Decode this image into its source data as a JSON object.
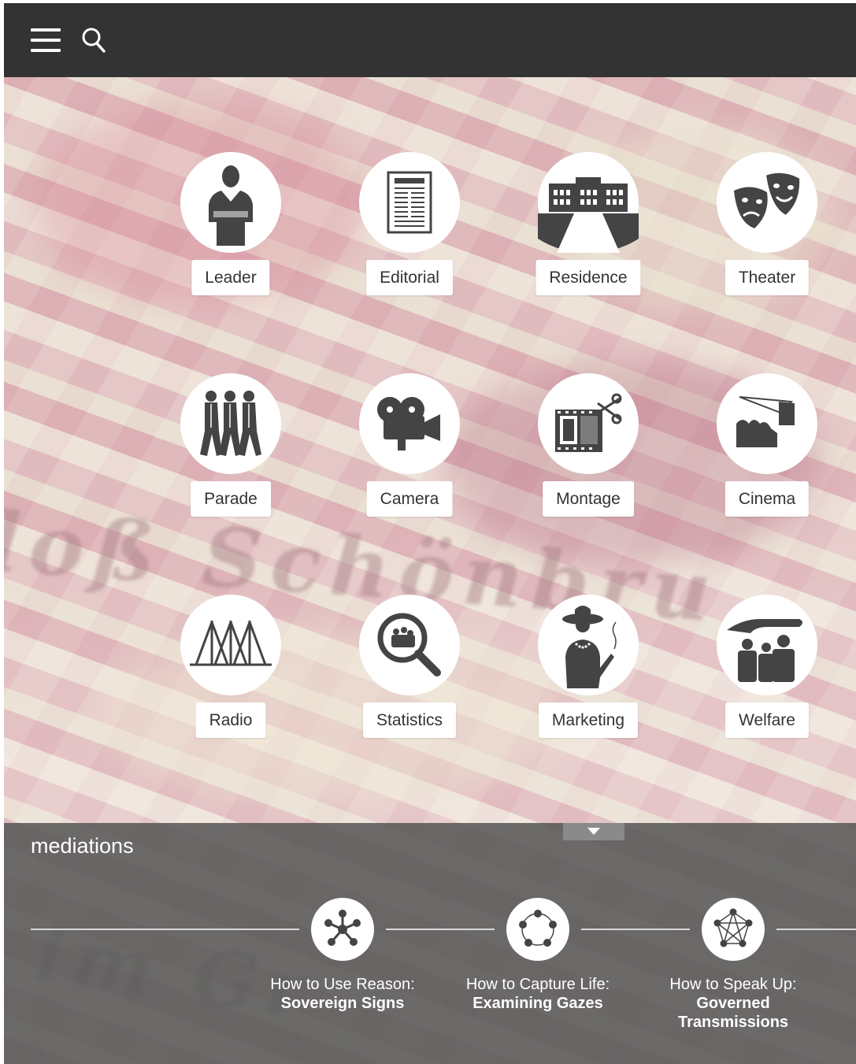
{
  "header": {
    "menu_icon": "hamburger-menu-icon",
    "search_icon": "search-icon",
    "bg_color": "#333333"
  },
  "grid": {
    "items": [
      {
        "label": "Leader",
        "icon": "leader-icon"
      },
      {
        "label": "Editorial",
        "icon": "newspaper-icon"
      },
      {
        "label": "Residence",
        "icon": "palace-icon"
      },
      {
        "label": "Theater",
        "icon": "theater-masks-icon"
      },
      {
        "label": "Parade",
        "icon": "marching-soldiers-icon"
      },
      {
        "label": "Camera",
        "icon": "film-camera-icon"
      },
      {
        "label": "Montage",
        "icon": "film-scissors-icon"
      },
      {
        "label": "Cinema",
        "icon": "projector-beam-icon"
      },
      {
        "label": "Radio",
        "icon": "radio-tower-icon"
      },
      {
        "label": "Statistics",
        "icon": "magnifier-crowd-icon"
      },
      {
        "label": "Marketing",
        "icon": "woman-smoking-icon"
      },
      {
        "label": "Welfare",
        "icon": "protecting-hand-icon"
      }
    ]
  },
  "mediations": {
    "title": "mediations",
    "nodes": [
      {
        "line1": "How to Use Reason:",
        "line2": "Sovereign Signs",
        "icon": "star-network-icon"
      },
      {
        "line1": "How to Capture Life:",
        "line2": "Examining Gazes",
        "icon": "ring-network-icon"
      },
      {
        "line1": "How to Speak Up:",
        "line2": "Governed Transmissions",
        "icon": "mesh-network-icon"
      }
    ]
  }
}
